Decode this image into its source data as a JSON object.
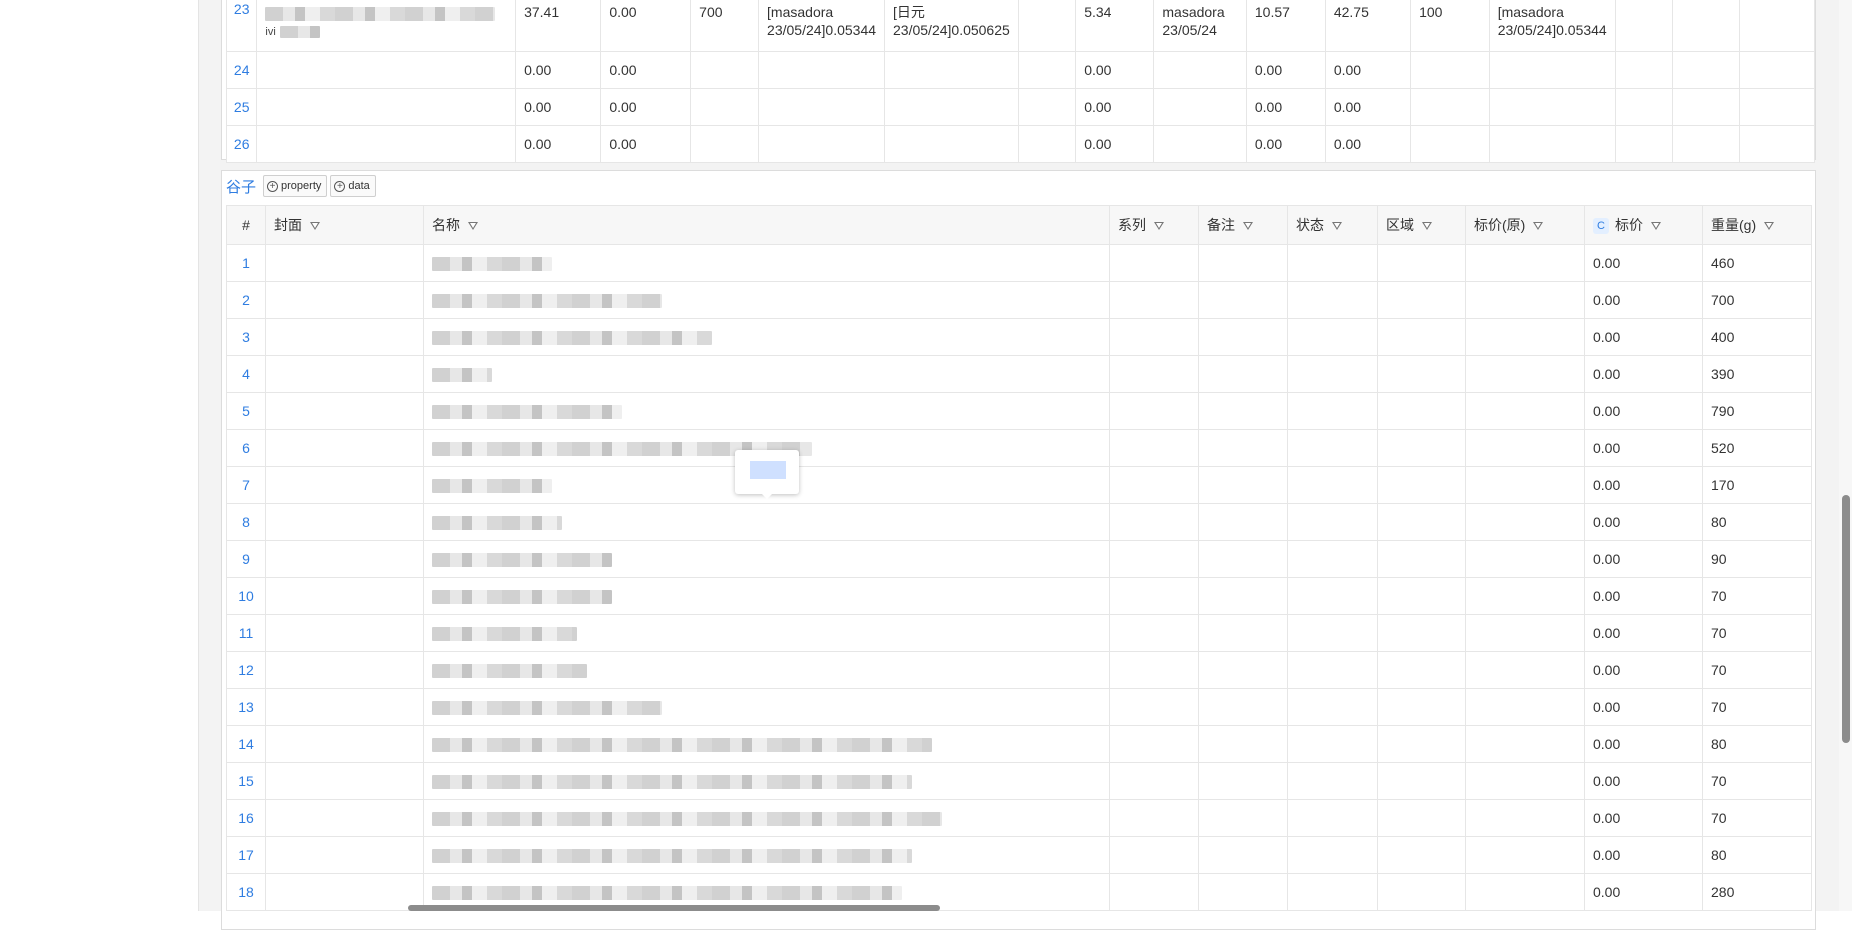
{
  "top_table": {
    "rows": [
      {
        "num": "23",
        "name_extra": "ivi",
        "c1": "37.41",
        "c2": "0.00",
        "c3": "700",
        "c4": "[masadora 23/05/24]0.05344",
        "c5": "[日元 23/05/24]0.050625",
        "c6": "",
        "c7": "5.34",
        "c8": "masadora 23/05/24",
        "c9": "10.57",
        "c10": "42.75",
        "c11": "100",
        "c12": "[masadora 23/05/24]0.05344"
      },
      {
        "num": "24",
        "c1": "0.00",
        "c2": "0.00",
        "c7": "0.00",
        "c9": "0.00",
        "c10": "0.00"
      },
      {
        "num": "25",
        "c1": "0.00",
        "c2": "0.00",
        "c7": "0.00",
        "c9": "0.00",
        "c10": "0.00"
      },
      {
        "num": "26",
        "c1": "0.00",
        "c2": "0.00",
        "c7": "0.00",
        "c9": "0.00",
        "c10": "0.00"
      }
    ]
  },
  "main_panel": {
    "title": "谷子",
    "property_button": "property",
    "data_button": "data",
    "columns": {
      "num": "#",
      "cover": "封面",
      "name": "名称",
      "series": "系列",
      "note": "备注",
      "status": "状态",
      "region": "区域",
      "price_orig": "标价(原)",
      "price_badge": "C",
      "price": "标价",
      "weight": "重量(g)"
    },
    "rows": [
      {
        "num": "1",
        "price": "0.00",
        "weight": "460"
      },
      {
        "num": "2",
        "price": "0.00",
        "weight": "700"
      },
      {
        "num": "3",
        "price": "0.00",
        "weight": "400"
      },
      {
        "num": "4",
        "price": "0.00",
        "weight": "390"
      },
      {
        "num": "5",
        "price": "0.00",
        "weight": "790"
      },
      {
        "num": "6",
        "price": "0.00",
        "weight": "520"
      },
      {
        "num": "7",
        "price": "0.00",
        "weight": "170"
      },
      {
        "num": "8",
        "price": "0.00",
        "weight": "80"
      },
      {
        "num": "9",
        "price": "0.00",
        "weight": "90"
      },
      {
        "num": "10",
        "price": "0.00",
        "weight": "70"
      },
      {
        "num": "11",
        "price": "0.00",
        "weight": "70"
      },
      {
        "num": "12",
        "price": "0.00",
        "weight": "70"
      },
      {
        "num": "13",
        "price": "0.00",
        "weight": "70"
      },
      {
        "num": "14",
        "price": "0.00",
        "weight": "80"
      },
      {
        "num": "15",
        "price": "0.00",
        "weight": "70"
      },
      {
        "num": "16",
        "price": "0.00",
        "weight": "70"
      },
      {
        "num": "17",
        "price": "0.00",
        "weight": "80"
      },
      {
        "num": "18",
        "price": "0.00",
        "weight": "280"
      }
    ]
  },
  "colors": {
    "accent": "#2f7de1",
    "header_bg": "#f7f7f7",
    "border": "#e6e6e6",
    "page_bg": "#f3f3f3"
  }
}
